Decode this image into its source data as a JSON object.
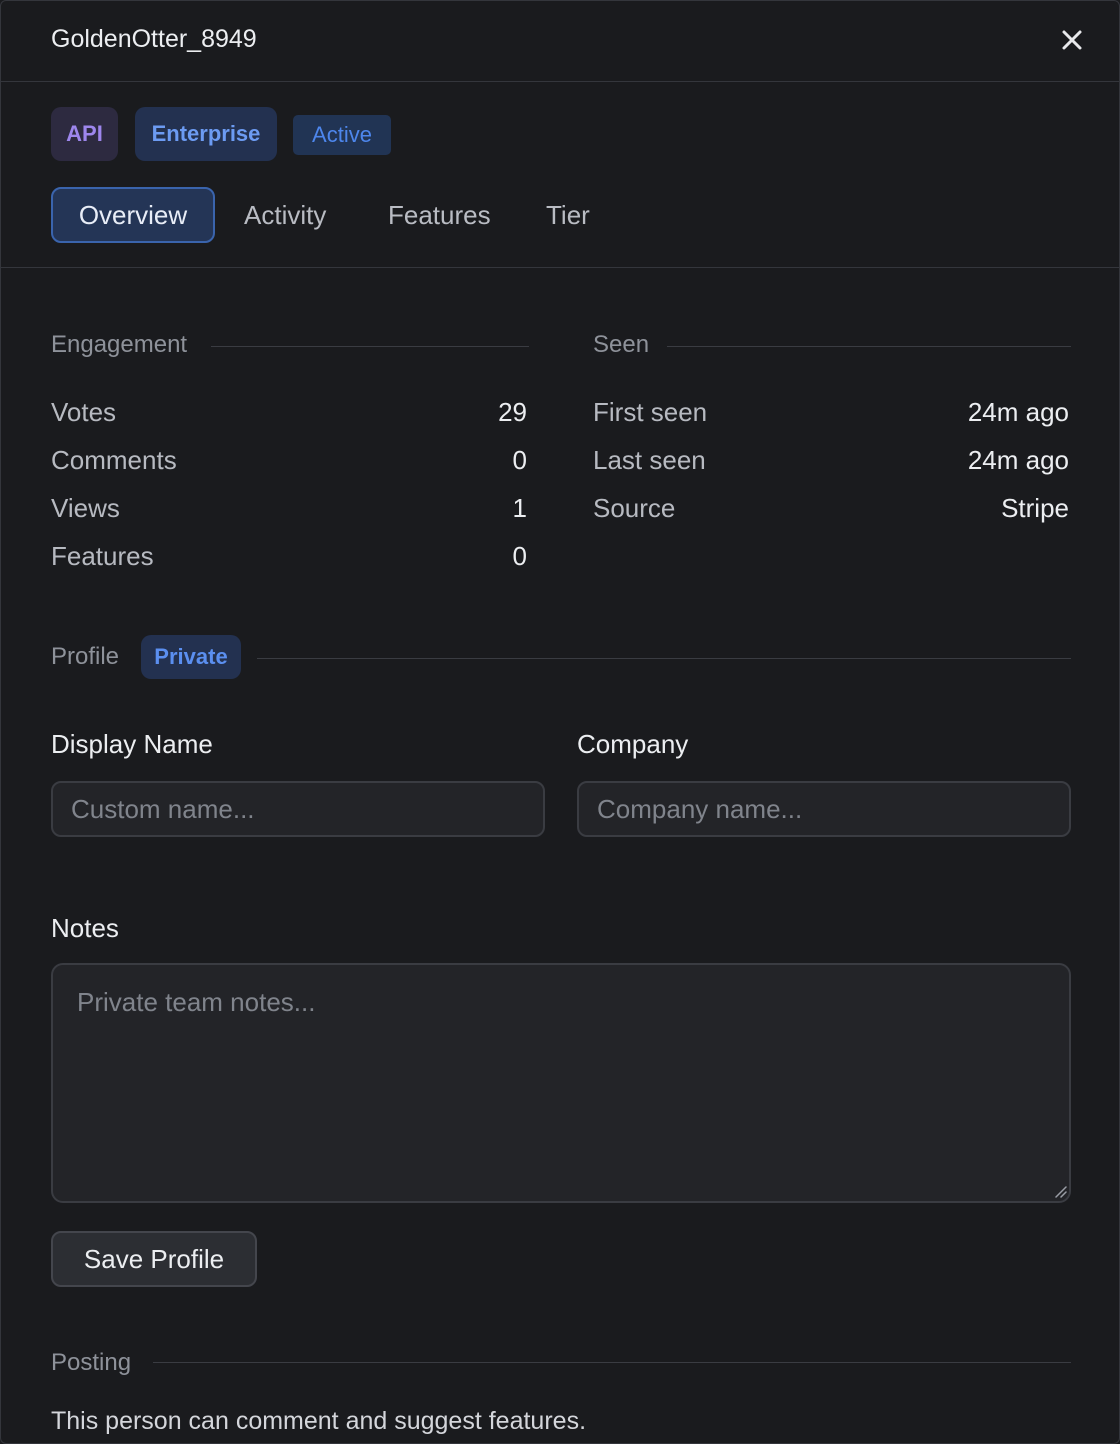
{
  "header": {
    "title": "GoldenOtter_8949",
    "close_icon": "close-icon"
  },
  "badges": {
    "api": "API",
    "tier": "Enterprise",
    "status": "Active"
  },
  "tabs": [
    {
      "label": "Overview",
      "active": true
    },
    {
      "label": "Activity",
      "active": false
    },
    {
      "label": "Features",
      "active": false
    },
    {
      "label": "Tier",
      "active": false
    }
  ],
  "engagement": {
    "title": "Engagement",
    "rows": [
      {
        "label": "Votes",
        "value": "29"
      },
      {
        "label": "Comments",
        "value": "0"
      },
      {
        "label": "Views",
        "value": "1"
      },
      {
        "label": "Features",
        "value": "0"
      }
    ]
  },
  "seen": {
    "title": "Seen",
    "rows": [
      {
        "label": "First seen",
        "value": "24m ago"
      },
      {
        "label": "Last seen",
        "value": "24m ago"
      },
      {
        "label": "Source",
        "value": "Stripe"
      }
    ]
  },
  "profile": {
    "title": "Profile",
    "visibility": "Private",
    "display_name_label": "Display Name",
    "display_name_placeholder": "Custom name...",
    "display_name_value": "",
    "company_label": "Company",
    "company_placeholder": "Company name...",
    "company_value": "",
    "notes_label": "Notes",
    "notes_placeholder": "Private team notes...",
    "notes_value": "",
    "save_label": "Save Profile"
  },
  "posting": {
    "title": "Posting",
    "text": "This person can comment and suggest features."
  },
  "colors": {
    "background": "#1a1b1e",
    "accent": "#4d86ec",
    "api_badge": "#9d86ec",
    "active_tab_border": "#3a64ad"
  }
}
